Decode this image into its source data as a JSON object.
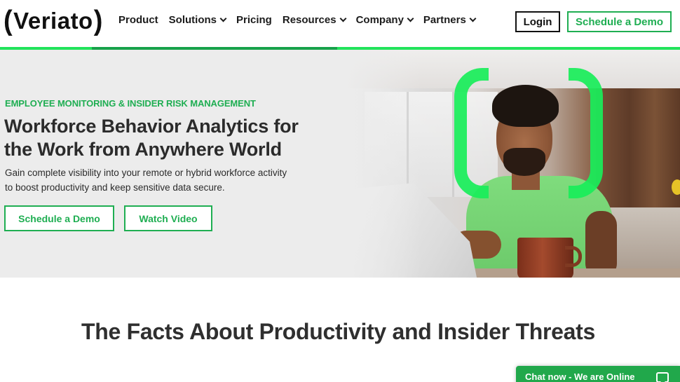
{
  "brand": {
    "name": "Veriato",
    "left_bracket": "(",
    "right_bracket": ")",
    "accent_color": "#1fae52",
    "bright_green": "#19ee5a"
  },
  "nav": {
    "items": [
      {
        "label": "Product",
        "has_dropdown": false
      },
      {
        "label": "Solutions",
        "has_dropdown": true
      },
      {
        "label": "Pricing",
        "has_dropdown": false
      },
      {
        "label": "Resources",
        "has_dropdown": true
      },
      {
        "label": "Company",
        "has_dropdown": true
      },
      {
        "label": "Partners",
        "has_dropdown": true
      }
    ],
    "login_label": "Login",
    "demo_label": "Schedule a Demo"
  },
  "hero": {
    "eyebrow": "EMPLOYEE MONITORING & INSIDER RISK MANAGEMENT",
    "headline_line1": "Workforce Behavior Analytics for",
    "headline_line2": "the Work from Anywhere World",
    "subtext_line1": "Gain complete visibility into your remote or hybrid workforce activity",
    "subtext_line2": "to boost productivity and keep sensitive data secure.",
    "primary_button": "Schedule a Demo",
    "secondary_button": "Watch Video",
    "image_description": "Man in green t-shirt working on laptop with coffee mug, framed by green brackets"
  },
  "facts": {
    "title": "The Facts About Productivity and Insider Threats"
  },
  "chat": {
    "label": "Chat now - We are Online",
    "icon": "chat-bubble-icon"
  }
}
